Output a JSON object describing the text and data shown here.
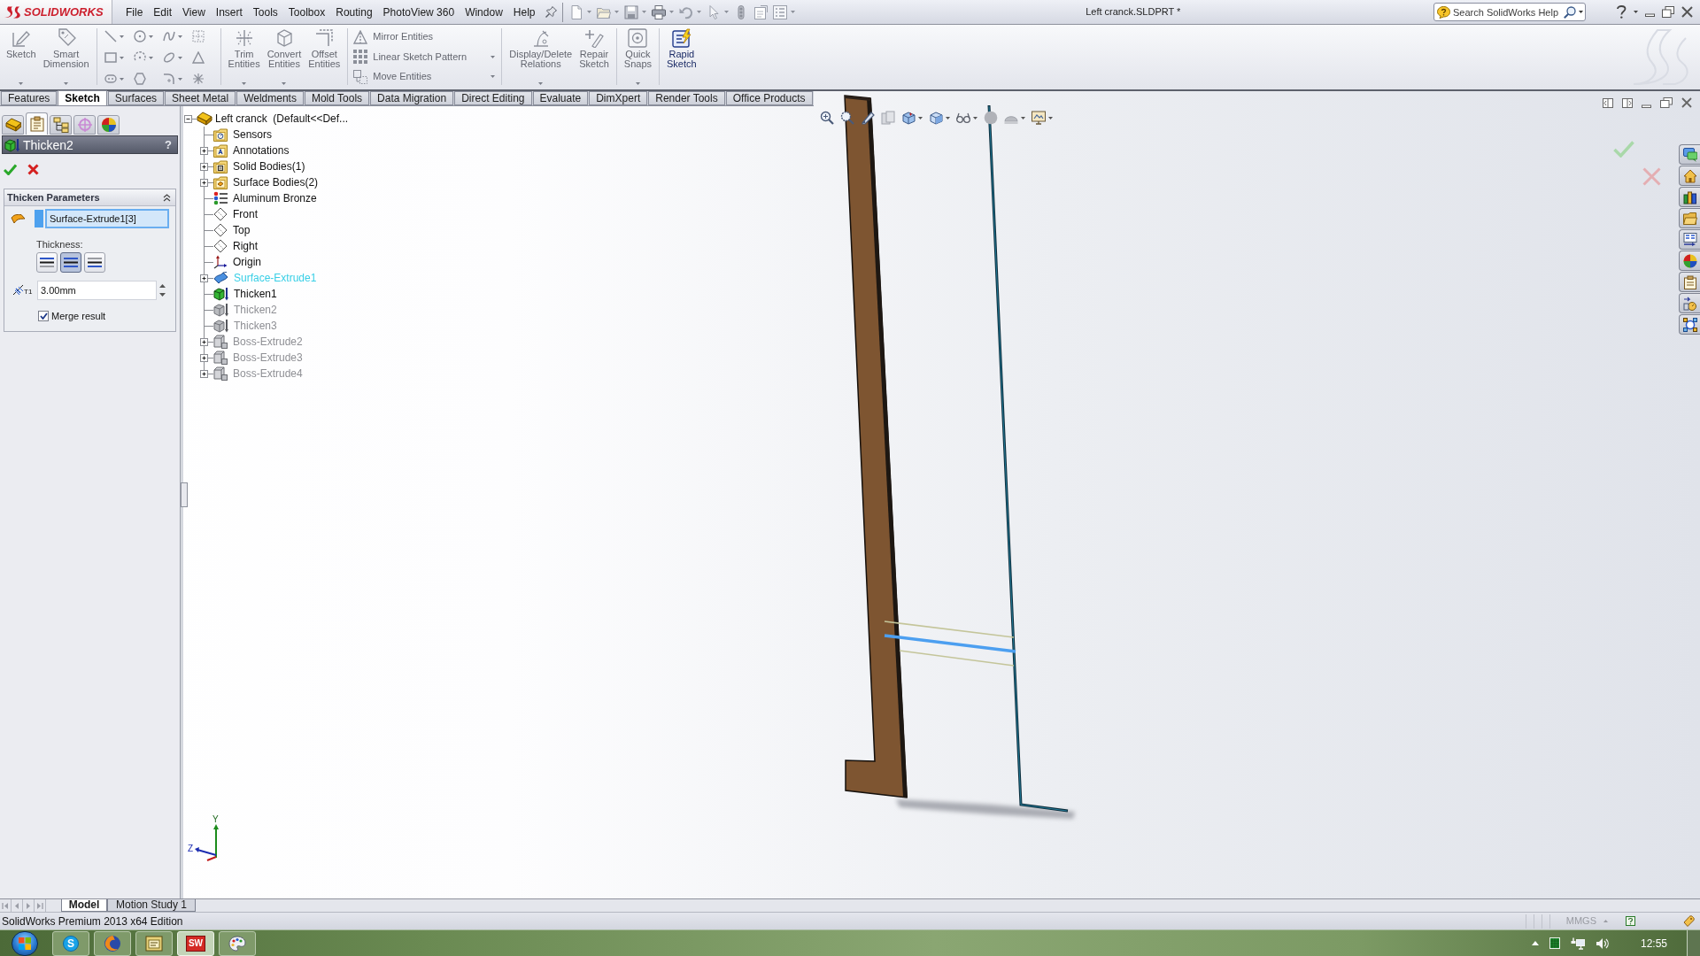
{
  "app": {
    "name": "SOLIDWORKS"
  },
  "menu_bar": {
    "items": [
      "File",
      "Edit",
      "View",
      "Insert",
      "Tools",
      "Toolbox",
      "Routing",
      "PhotoView 360",
      "Window",
      "Help"
    ]
  },
  "window": {
    "title": "Left cranck.SLDPRT *"
  },
  "search": {
    "placeholder": "Search SolidWorks Help"
  },
  "command_manager": {
    "groups": [
      {
        "kind": "large",
        "buttons": [
          {
            "label": "Sketch",
            "disabled": true,
            "dropdown": true
          },
          {
            "label": "Smart Dimension",
            "disabled": true,
            "dropdown": true
          }
        ]
      },
      {
        "kind": "grid"
      },
      {
        "kind": "large",
        "buttons": [
          {
            "label": "Trim Entities",
            "disabled": true,
            "dropdown": true
          },
          {
            "label": "Convert Entities",
            "disabled": true,
            "dropdown": true
          },
          {
            "label": "Offset Entities",
            "disabled": true,
            "dropdown": false
          }
        ]
      },
      {
        "kind": "stack",
        "buttons": [
          {
            "label": "Mirror Entities",
            "disabled": true,
            "dropdown": false
          },
          {
            "label": "Linear Sketch Pattern",
            "disabled": true,
            "dropdown": true
          },
          {
            "label": "Move Entities",
            "disabled": true,
            "dropdown": true
          }
        ]
      },
      {
        "kind": "large",
        "buttons": [
          {
            "label": "Display/Delete Relations",
            "disabled": true,
            "dropdown": true
          },
          {
            "label": "Repair Sketch",
            "disabled": true,
            "dropdown": false
          }
        ]
      },
      {
        "kind": "large",
        "buttons": [
          {
            "label": "Quick Snaps",
            "disabled": true,
            "dropdown": true
          }
        ]
      },
      {
        "kind": "large",
        "buttons": [
          {
            "label": "Rapid Sketch",
            "disabled": false,
            "dropdown": false
          }
        ]
      }
    ]
  },
  "tabs": [
    {
      "label": "Features",
      "selected": false
    },
    {
      "label": "Sketch",
      "selected": true
    },
    {
      "label": "Surfaces",
      "selected": false
    },
    {
      "label": "Sheet Metal",
      "selected": false
    },
    {
      "label": "Weldments",
      "selected": false
    },
    {
      "label": "Mold Tools",
      "selected": false
    },
    {
      "label": "Data Migration",
      "selected": false
    },
    {
      "label": "Direct Editing",
      "selected": false
    },
    {
      "label": "Evaluate",
      "selected": false
    },
    {
      "label": "DimXpert",
      "selected": false
    },
    {
      "label": "Render Tools",
      "selected": false
    },
    {
      "label": "Office Products",
      "selected": false
    }
  ],
  "property_manager": {
    "tabs": [
      {
        "selected": false
      },
      {
        "selected": true
      },
      {
        "selected": false
      },
      {
        "selected": false
      },
      {
        "selected": false
      }
    ],
    "title": "Thicken2",
    "help": "?",
    "group": {
      "title": "Thicken Parameters",
      "expanded": true,
      "selection": "Surface-Extrude1[3]",
      "thickness_label": "Thickness:",
      "thickness_options": [
        {
          "selected": false
        },
        {
          "selected": true
        },
        {
          "selected": false
        }
      ],
      "symbol": "T1",
      "thickness": "3.00mm",
      "merge": {
        "label": "Merge result",
        "checked": true
      }
    }
  },
  "feature_tree": {
    "root": {
      "label": "Left cranck  (Default<<Def...",
      "kind": "part",
      "expanded": true,
      "selected": false,
      "rolled_back": false,
      "children": [
        {
          "label": "Sensors",
          "kind": "sensors",
          "selected": false,
          "rolled_back": false
        },
        {
          "label": "Annotations",
          "kind": "annotations",
          "expanded": false,
          "selected": false,
          "rolled_back": false
        },
        {
          "label": "Solid Bodies(1)",
          "kind": "bodies",
          "expanded": false,
          "selected": false,
          "rolled_back": false
        },
        {
          "label": "Surface Bodies(2)",
          "kind": "surfaces",
          "expanded": false,
          "selected": false,
          "rolled_back": false
        },
        {
          "label": "Aluminum Bronze",
          "kind": "material",
          "selected": false,
          "rolled_back": false
        },
        {
          "label": "Front",
          "kind": "plane",
          "selected": false,
          "rolled_back": false
        },
        {
          "label": "Top",
          "kind": "plane",
          "selected": false,
          "rolled_back": false
        },
        {
          "label": "Right",
          "kind": "plane",
          "selected": false,
          "rolled_back": false
        },
        {
          "label": "Origin",
          "kind": "origin",
          "selected": false,
          "rolled_back": false
        },
        {
          "label": "Surface-Extrude1",
          "kind": "surface",
          "expanded": false,
          "selected": true,
          "rolled_back": false
        },
        {
          "label": "Thicken1",
          "kind": "thicken",
          "selected": false,
          "rolled_back": false
        },
        {
          "label": "Thicken2",
          "kind": "thicken",
          "selected": false,
          "rolled_back": true
        },
        {
          "label": "Thicken3",
          "kind": "thicken",
          "selected": false,
          "rolled_back": true
        },
        {
          "label": "Boss-Extrude2",
          "kind": "boss",
          "expanded": false,
          "selected": false,
          "rolled_back": true
        },
        {
          "label": "Boss-Extrude3",
          "kind": "boss",
          "expanded": false,
          "selected": false,
          "rolled_back": true
        },
        {
          "label": "Boss-Extrude4",
          "kind": "boss",
          "expanded": false,
          "selected": false,
          "rolled_back": true
        }
      ]
    }
  },
  "triad": {
    "labels": [
      "Y",
      "Z"
    ]
  },
  "model_tabs": [
    {
      "label": "Model",
      "selected": true
    },
    {
      "label": "Motion Study 1",
      "selected": false
    }
  ],
  "status_bar": {
    "text": "SolidWorks Premium 2013 x64 Edition",
    "units": "MMGS"
  },
  "taskbar": {
    "apps": [
      {
        "kind": "disc",
        "glyph": "S",
        "selected": false
      },
      {
        "kind": "globe",
        "selected": false
      },
      {
        "kind": "window",
        "selected": false
      },
      {
        "kind": "tile",
        "glyph": "SW",
        "selected": true
      },
      {
        "kind": "palette",
        "selected": false
      }
    ],
    "clock": "12:55"
  }
}
